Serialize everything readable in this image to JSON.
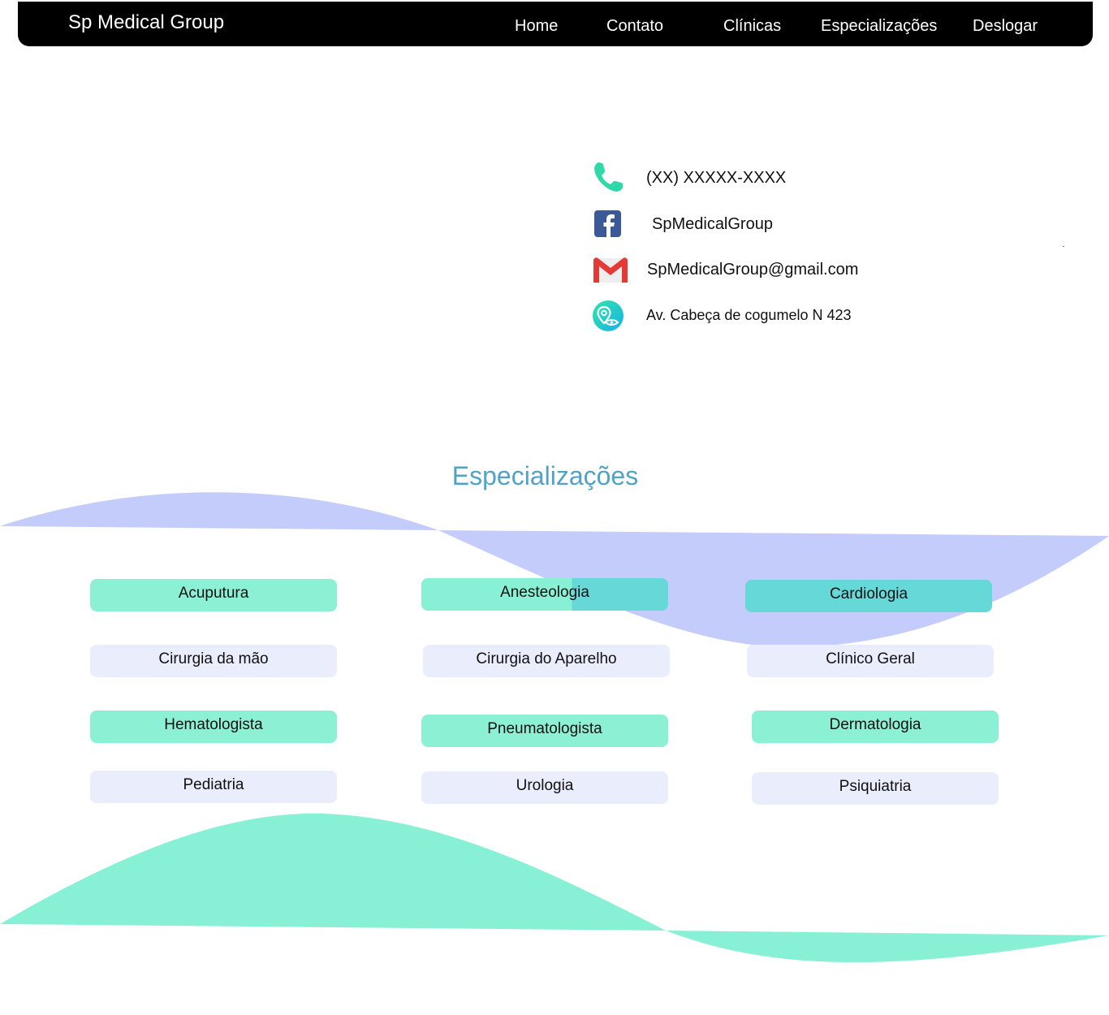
{
  "nav": {
    "brand": "Sp Medical Group",
    "links": [
      "Home",
      "Contato",
      "Clínicas",
      "Especializações",
      "Deslogar"
    ]
  },
  "contact": {
    "phone": "(XX) XXXXX-XXXX",
    "facebook": "SpMedicalGroup",
    "email": "SpMedicalGroup@gmail.com",
    "address": "Av. Cabeça de cogumelo N 423"
  },
  "specializations": {
    "title": "Especializações",
    "items": [
      "Acuputura",
      "Anesteologia",
      "Cardiologia",
      "Cirurgia da mão",
      "Cirurgia do Aparelho",
      "Clínico Geral",
      "Hematologista",
      "Pneumatologista",
      "Dermatologia",
      "Pediatria",
      "Urologia",
      "Psiquiatria"
    ]
  },
  "colors": {
    "navbar": "#000000",
    "title": "#4fa3c7",
    "wave_blue": "#c3ccfb",
    "wave_green": "#88f0d4",
    "card_green": "#88f0d4",
    "card_light": "#eaedfc",
    "card_teal": "#66d8d8",
    "phone_icon": "#2ed8a8",
    "facebook_icon": "#3b5998",
    "gmail_red": "#e53935"
  },
  "icons": [
    "phone-icon",
    "facebook-icon",
    "gmail-icon",
    "location-icon"
  ]
}
